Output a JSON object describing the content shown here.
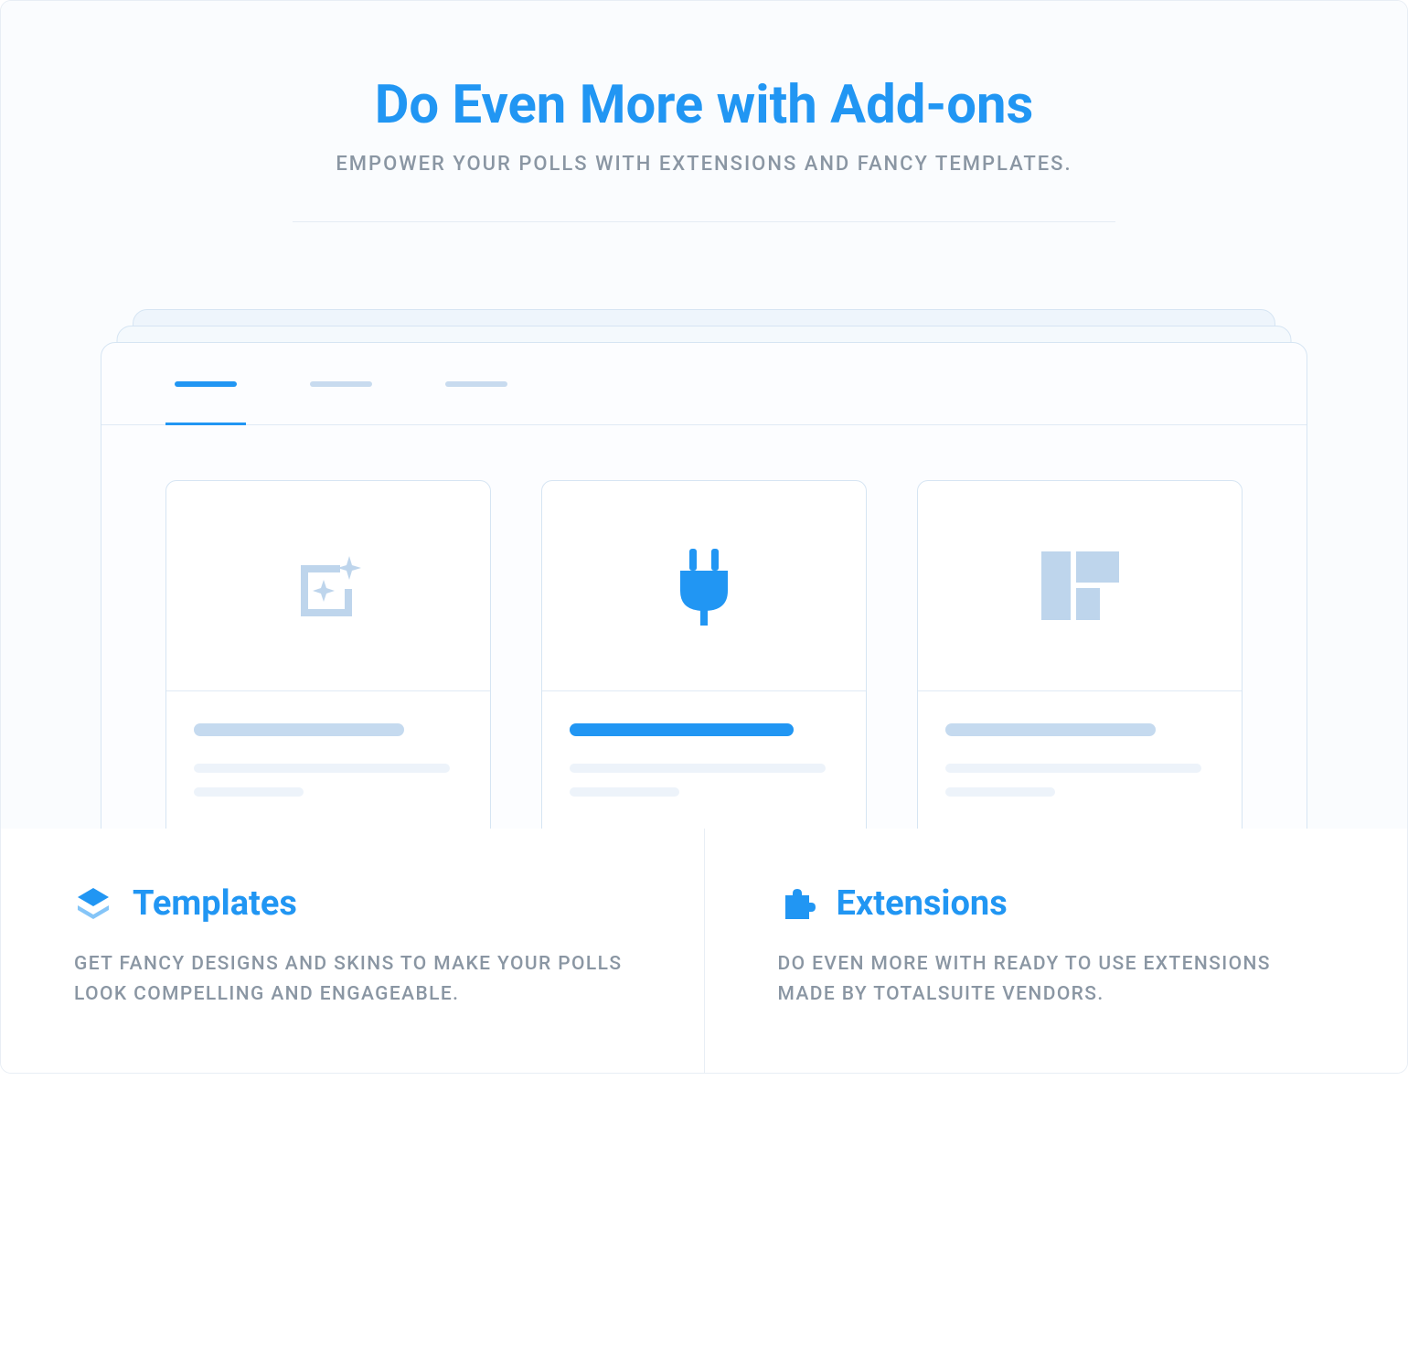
{
  "hero": {
    "title": "Do Even More with Add-ons",
    "subtitle": "EMPOWER YOUR POLLS WITH EXTENSIONS AND FANCY TEMPLATES."
  },
  "colors": {
    "primary": "#2196f3",
    "muted": "#c5daef",
    "text_secondary": "#8a96a3"
  },
  "illustration": {
    "cards": [
      {
        "icon": "sparkle",
        "highlight": false
      },
      {
        "icon": "plug",
        "highlight": true
      },
      {
        "icon": "grid",
        "highlight": false
      }
    ]
  },
  "features": [
    {
      "icon": "layers",
      "title": "Templates",
      "description": "GET FANCY DESIGNS AND SKINS TO MAKE YOUR POLLS LOOK COMPELLING AND ENGAGEABLE."
    },
    {
      "icon": "puzzle",
      "title": "Extensions",
      "description": "DO EVEN MORE WITH READY TO USE EXTENSIONS MADE BY TOTALSUITE VENDORS."
    }
  ]
}
